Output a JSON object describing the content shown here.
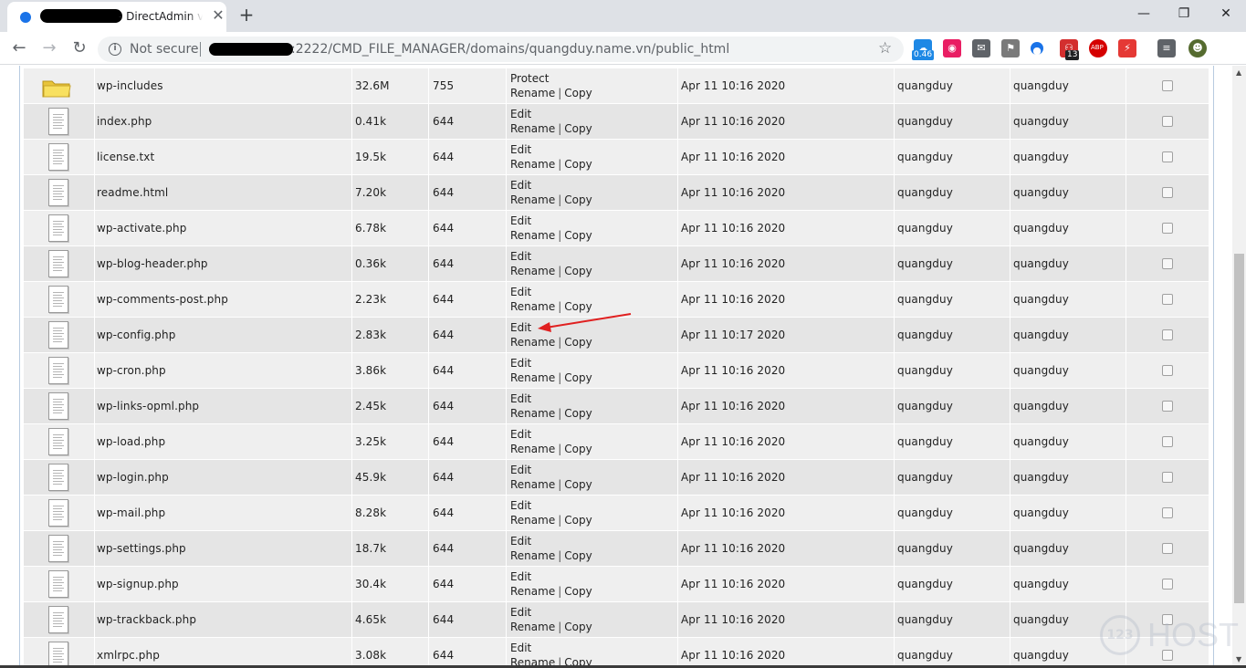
{
  "browser": {
    "tab_title": "- DirectAdmin v1.",
    "tab_close": "✕",
    "new_tab": "+",
    "window_controls": {
      "minimize": "—",
      "restore": "❐",
      "close": "✕"
    },
    "nav": {
      "back": "←",
      "forward": "→",
      "reload": "↻"
    },
    "security_label": "Not secure",
    "url": ":2222/CMD_FILE_MANAGER/domains/quangduy.name.vn/public_html",
    "extensions": [
      {
        "name": "weather-extension",
        "badge": "0.46",
        "color": "#1e88e5"
      },
      {
        "name": "eye-extension",
        "badge": "",
        "color": "#e91e63"
      },
      {
        "name": "mail-extension",
        "badge": "",
        "color": "#5f6368"
      },
      {
        "name": "flag-extension",
        "badge": "",
        "color": "#7a7a7a"
      },
      {
        "name": "blue-dot-extension",
        "badge": "",
        "color": "#1a73e8"
      },
      {
        "name": "people-extension",
        "badge": "13",
        "color": "#d32f2f"
      },
      {
        "name": "adblock-extension",
        "badge": "ABP",
        "color": "#d50000"
      },
      {
        "name": "bolt-extension",
        "badge": "",
        "color": "#e53935"
      },
      {
        "name": "playlist-extension",
        "badge": "",
        "color": "#5f6368"
      },
      {
        "name": "profile-avatar",
        "badge": "",
        "color": "#556b2f"
      }
    ]
  },
  "file_rows": [
    {
      "type": "folder",
      "name": "wp-includes",
      "size": "32.6M",
      "perm": "755",
      "action1": "Protect",
      "rename": "Rename",
      "copy": "Copy",
      "date": "Apr 11 10:16 2020",
      "owner": "quangduy",
      "group": "quangduy"
    },
    {
      "type": "file",
      "name": "index.php",
      "size": "0.41k",
      "perm": "644",
      "action1": "Edit",
      "rename": "Rename",
      "copy": "Copy",
      "date": "Apr 11 10:16 2020",
      "owner": "quangduy",
      "group": "quangduy"
    },
    {
      "type": "file",
      "name": "license.txt",
      "size": "19.5k",
      "perm": "644",
      "action1": "Edit",
      "rename": "Rename",
      "copy": "Copy",
      "date": "Apr 11 10:16 2020",
      "owner": "quangduy",
      "group": "quangduy"
    },
    {
      "type": "file",
      "name": "readme.html",
      "size": "7.20k",
      "perm": "644",
      "action1": "Edit",
      "rename": "Rename",
      "copy": "Copy",
      "date": "Apr 11 10:16 2020",
      "owner": "quangduy",
      "group": "quangduy"
    },
    {
      "type": "file",
      "name": "wp-activate.php",
      "size": "6.78k",
      "perm": "644",
      "action1": "Edit",
      "rename": "Rename",
      "copy": "Copy",
      "date": "Apr 11 10:16 2020",
      "owner": "quangduy",
      "group": "quangduy"
    },
    {
      "type": "file",
      "name": "wp-blog-header.php",
      "size": "0.36k",
      "perm": "644",
      "action1": "Edit",
      "rename": "Rename",
      "copy": "Copy",
      "date": "Apr 11 10:16 2020",
      "owner": "quangduy",
      "group": "quangduy"
    },
    {
      "type": "file",
      "name": "wp-comments-post.php",
      "size": "2.23k",
      "perm": "644",
      "action1": "Edit",
      "rename": "Rename",
      "copy": "Copy",
      "date": "Apr 11 10:16 2020",
      "owner": "quangduy",
      "group": "quangduy"
    },
    {
      "type": "file",
      "name": "wp-config.php",
      "size": "2.83k",
      "perm": "644",
      "action1": "Edit",
      "rename": "Rename",
      "copy": "Copy",
      "date": "Apr 11 10:17 2020",
      "owner": "quangduy",
      "group": "quangduy"
    },
    {
      "type": "file",
      "name": "wp-cron.php",
      "size": "3.86k",
      "perm": "644",
      "action1": "Edit",
      "rename": "Rename",
      "copy": "Copy",
      "date": "Apr 11 10:16 2020",
      "owner": "quangduy",
      "group": "quangduy"
    },
    {
      "type": "file",
      "name": "wp-links-opml.php",
      "size": "2.45k",
      "perm": "644",
      "action1": "Edit",
      "rename": "Rename",
      "copy": "Copy",
      "date": "Apr 11 10:16 2020",
      "owner": "quangduy",
      "group": "quangduy"
    },
    {
      "type": "file",
      "name": "wp-load.php",
      "size": "3.25k",
      "perm": "644",
      "action1": "Edit",
      "rename": "Rename",
      "copy": "Copy",
      "date": "Apr 11 10:16 2020",
      "owner": "quangduy",
      "group": "quangduy"
    },
    {
      "type": "file",
      "name": "wp-login.php",
      "size": "45.9k",
      "perm": "644",
      "action1": "Edit",
      "rename": "Rename",
      "copy": "Copy",
      "date": "Apr 11 10:16 2020",
      "owner": "quangduy",
      "group": "quangduy"
    },
    {
      "type": "file",
      "name": "wp-mail.php",
      "size": "8.28k",
      "perm": "644",
      "action1": "Edit",
      "rename": "Rename",
      "copy": "Copy",
      "date": "Apr 11 10:16 2020",
      "owner": "quangduy",
      "group": "quangduy"
    },
    {
      "type": "file",
      "name": "wp-settings.php",
      "size": "18.7k",
      "perm": "644",
      "action1": "Edit",
      "rename": "Rename",
      "copy": "Copy",
      "date": "Apr 11 10:16 2020",
      "owner": "quangduy",
      "group": "quangduy"
    },
    {
      "type": "file",
      "name": "wp-signup.php",
      "size": "30.4k",
      "perm": "644",
      "action1": "Edit",
      "rename": "Rename",
      "copy": "Copy",
      "date": "Apr 11 10:16 2020",
      "owner": "quangduy",
      "group": "quangduy"
    },
    {
      "type": "file",
      "name": "wp-trackback.php",
      "size": "4.65k",
      "perm": "644",
      "action1": "Edit",
      "rename": "Rename",
      "copy": "Copy",
      "date": "Apr 11 10:16 2020",
      "owner": "quangduy",
      "group": "quangduy"
    },
    {
      "type": "file",
      "name": "xmlrpc.php",
      "size": "3.08k",
      "perm": "644",
      "action1": "Edit",
      "rename": "Rename",
      "copy": "Copy",
      "date": "Apr 11 10:16 2020",
      "owner": "quangduy",
      "group": "quangduy"
    }
  ],
  "annotation": {
    "color": "#e02020",
    "points_to_row": 7
  },
  "watermark": {
    "circle_text": "123",
    "text": "HOST"
  }
}
